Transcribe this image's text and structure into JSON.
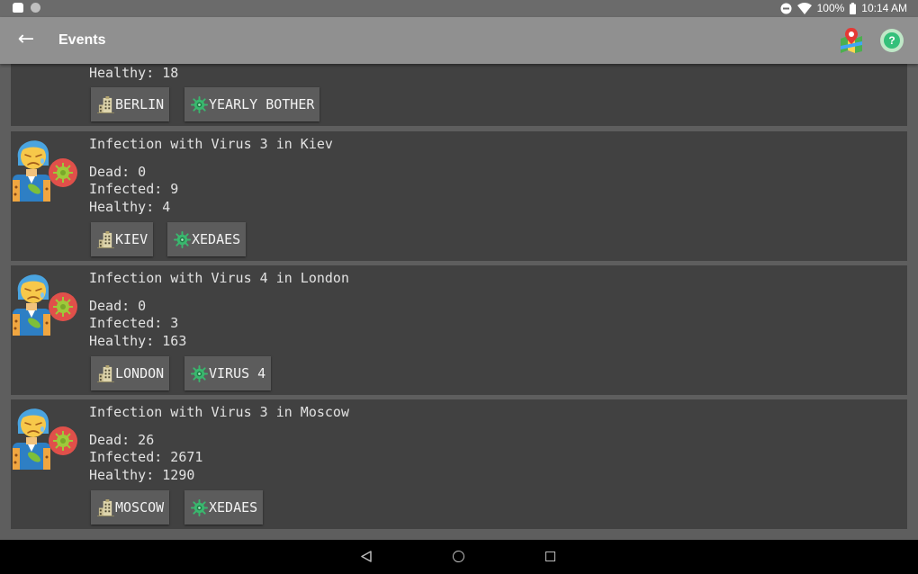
{
  "status_bar": {
    "battery": "100%",
    "time": "10:14 AM"
  },
  "app_bar": {
    "back_icon": "arrow-back-icon",
    "title": "Events",
    "map_icon": "map-pin-icon",
    "help_icon": "help-icon"
  },
  "top_partial": {
    "stats_cut": "Healthy: 18",
    "chips": [
      {
        "label": "BERLIN",
        "icon": "city-icon"
      },
      {
        "label": "YEARLY BOTHER",
        "icon": "virus-icon"
      }
    ]
  },
  "events": [
    {
      "title": "Infection with Virus 3 in Kiev",
      "dead": "Dead: 0",
      "infected": "Infected: 9",
      "healthy": "Healthy: 4",
      "chips": [
        {
          "label": "KIEV",
          "icon": "city-icon"
        },
        {
          "label": "XEDAES",
          "icon": "virus-icon"
        }
      ]
    },
    {
      "title": "Infection with Virus 4 in London",
      "dead": "Dead: 0",
      "infected": "Infected: 3",
      "healthy": "Healthy: 163",
      "chips": [
        {
          "label": "LONDON",
          "icon": "city-icon"
        },
        {
          "label": "VIRUS 4",
          "icon": "virus-icon"
        }
      ]
    },
    {
      "title": "Infection with Virus 3 in Moscow",
      "dead": "Dead: 26",
      "infected": "Infected: 2671",
      "healthy": "Healthy: 1290",
      "chips": [
        {
          "label": "MOSCOW",
          "icon": "city-icon"
        },
        {
          "label": "XEDAES",
          "icon": "virus-icon"
        }
      ]
    }
  ],
  "nav_bar": {
    "back": "nav-back-icon",
    "home": "nav-home-icon",
    "recents": "nav-recents-icon"
  },
  "colors": {
    "app_bar": "#909090",
    "card": "#414141",
    "chip": "#5c5c5c",
    "text": "#e2e2e2"
  }
}
